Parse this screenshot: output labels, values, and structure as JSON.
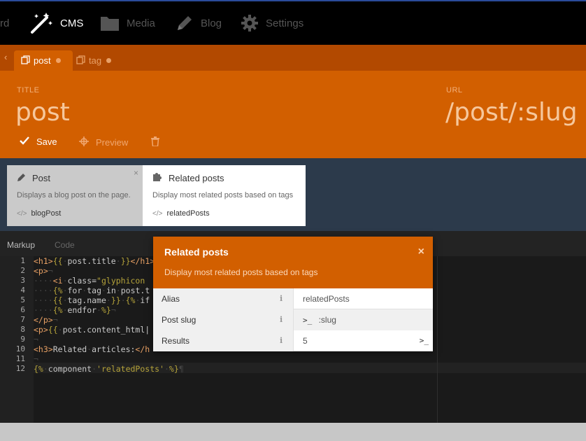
{
  "nav": {
    "items": [
      {
        "label": "rd",
        "icon": "dashboard-icon"
      },
      {
        "label": "CMS",
        "icon": "magic-wand-icon"
      },
      {
        "label": "Media",
        "icon": "folder-icon"
      },
      {
        "label": "Blog",
        "icon": "pencil-icon"
      },
      {
        "label": "Settings",
        "icon": "gear-icon"
      }
    ]
  },
  "tabs": {
    "back": "‹",
    "items": [
      {
        "label": "post",
        "icon": "copy-icon"
      },
      {
        "label": "tag",
        "icon": "copy-icon"
      }
    ]
  },
  "header": {
    "title_label": "TITLE",
    "title_value": "post",
    "url_label": "URL",
    "url_value": "/post/:slug",
    "save_label": "Save",
    "preview_label": "Preview"
  },
  "components": [
    {
      "title": "Post",
      "description": "Displays a blog post on the page.",
      "alias": "blogPost",
      "icon": "pencil-icon",
      "close": "×"
    },
    {
      "title": "Related posts",
      "description": "Display most related posts based on tags",
      "alias": "relatedPosts",
      "icon": "puzzle-icon"
    }
  ],
  "editor_tabs": {
    "markup": "Markup",
    "code": "Code"
  },
  "code": {
    "line_numbers": [
      "1",
      "2",
      "3",
      "4",
      "5",
      "6",
      "7",
      "8",
      "9",
      "10",
      "11",
      "12"
    ]
  },
  "popup": {
    "title": "Related posts",
    "description": "Display most related posts based on tags",
    "close": "×",
    "info": "i",
    "rows": [
      {
        "label": "Alias",
        "value": "relatedPosts"
      },
      {
        "label": "Post slug",
        "prompt": ">_",
        "value": ":slug"
      },
      {
        "label": "Results",
        "value": "5",
        "prompt": ">_"
      }
    ]
  },
  "colors": {
    "brand_orange": "#d25f00",
    "dark_orange": "#b24900",
    "nav_bg": "#000000",
    "panel_bg": "#2c3a4b"
  }
}
